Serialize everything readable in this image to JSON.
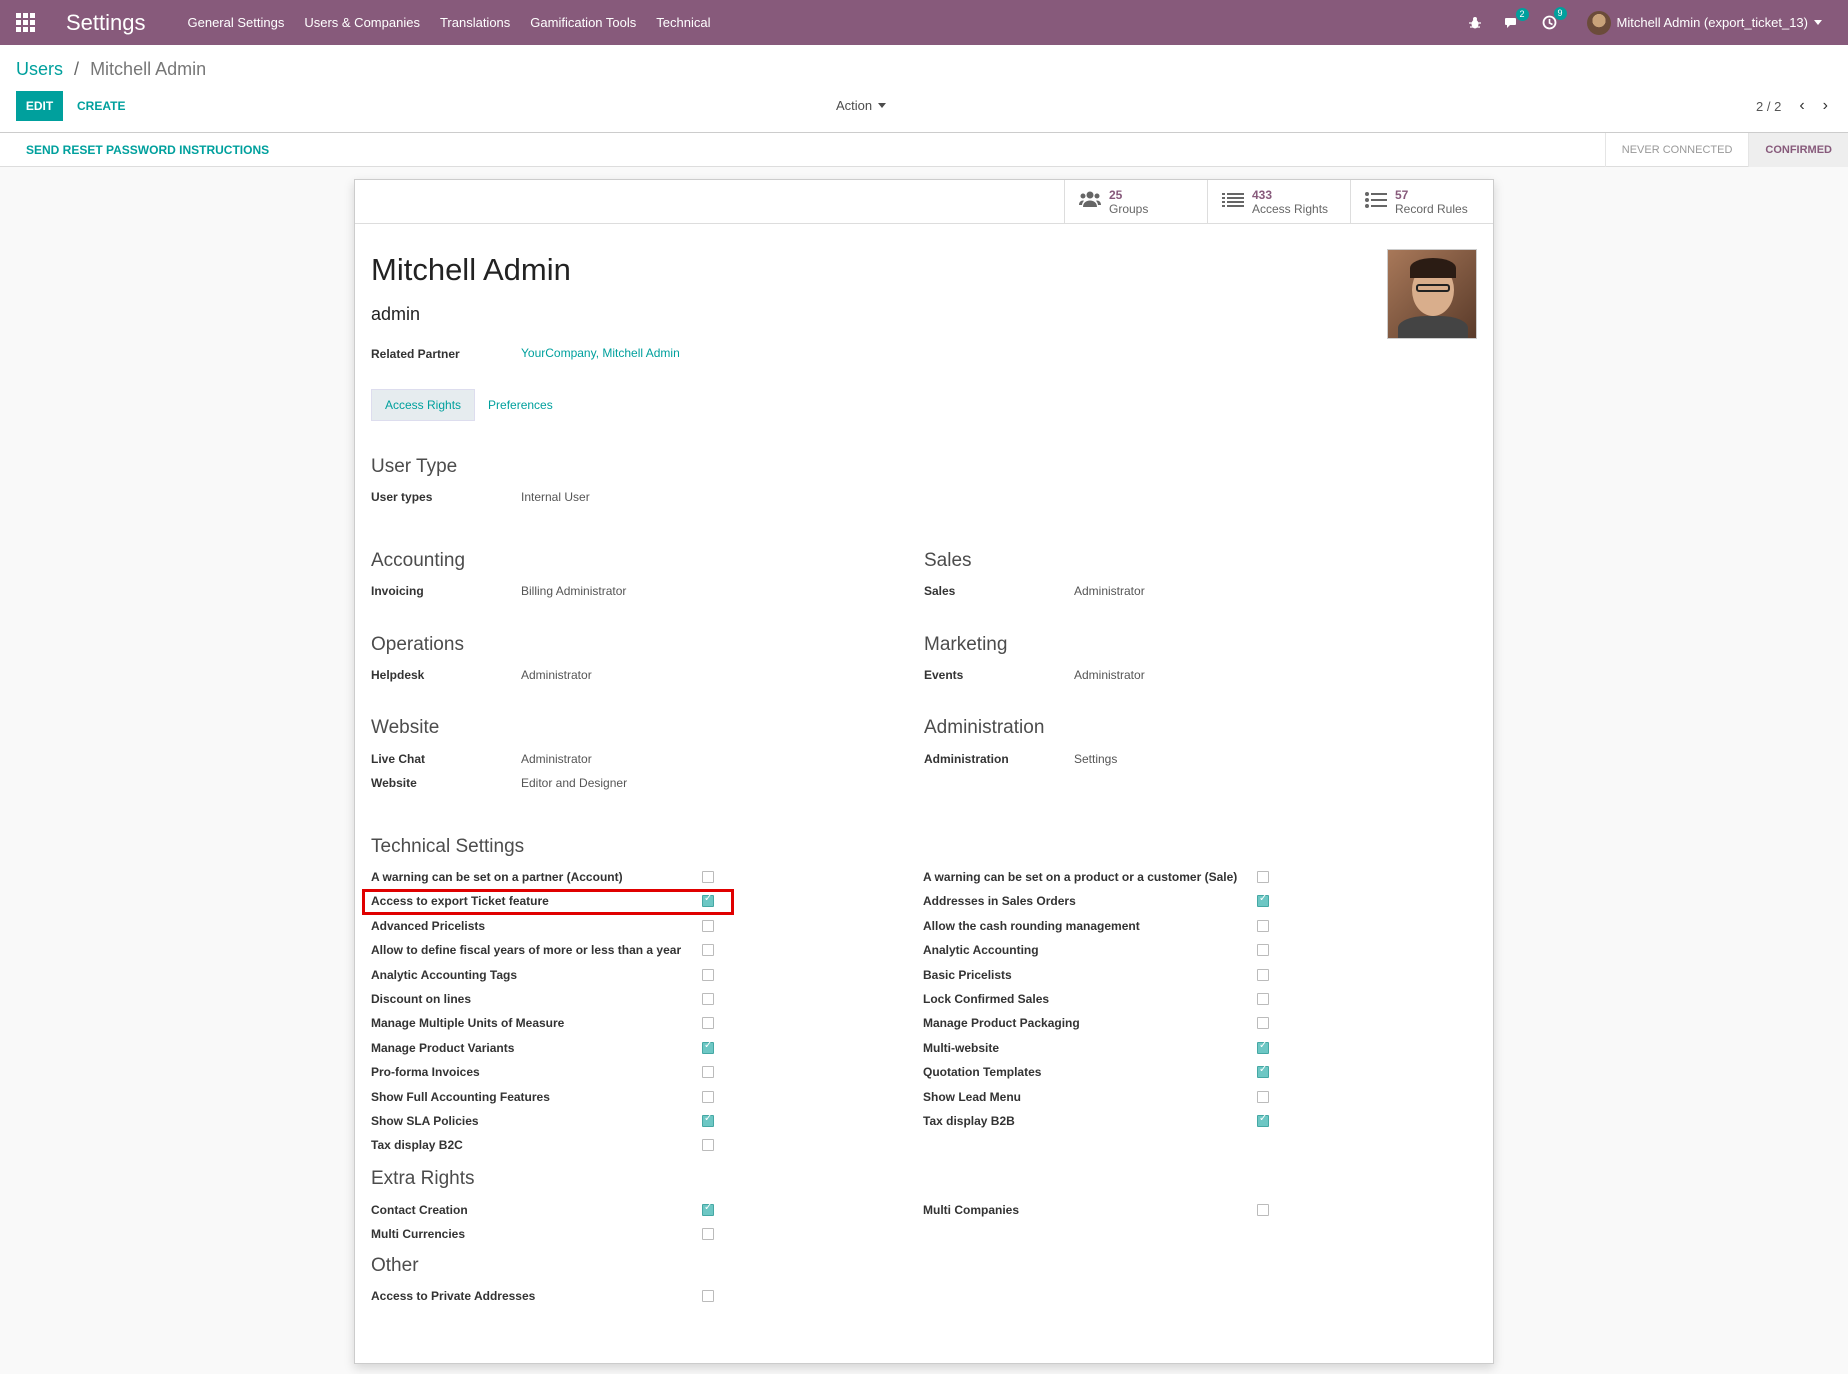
{
  "navbar": {
    "brand": "Settings",
    "menu": [
      "General Settings",
      "Users & Companies",
      "Translations",
      "Gamification Tools",
      "Technical"
    ],
    "messages_count": "2",
    "activities_count": "9",
    "user": "Mitchell Admin (export_ticket_13)",
    "color": "#875a7b"
  },
  "breadcrumb": {
    "parent": "Users",
    "separator": "/",
    "current": "Mitchell Admin"
  },
  "toolbar": {
    "edit": "EDIT",
    "create": "CREATE",
    "action": "Action",
    "pager": "2 / 2"
  },
  "statusbar": {
    "reset_password": "SEND RESET PASSWORD INSTRUCTIONS",
    "stages": [
      "NEVER CONNECTED",
      "CONFIRMED"
    ],
    "active_stage": "CONFIRMED"
  },
  "stats": [
    {
      "value": "25",
      "label": "Groups",
      "icon": "users-icon"
    },
    {
      "value": "433",
      "label": "Access Rights",
      "icon": "list-icon"
    },
    {
      "value": "57",
      "label": "Record Rules",
      "icon": "list-ul-icon"
    }
  ],
  "user": {
    "name": "Mitchell Admin",
    "login": "admin",
    "related_partner_label": "Related Partner",
    "related_partner": "YourCompany, Mitchell Admin"
  },
  "tabs": [
    "Access Rights",
    "Preferences"
  ],
  "user_type": {
    "title": "User Type",
    "label": "User types",
    "value": "Internal User"
  },
  "groups": {
    "accounting": {
      "title": "Accounting",
      "label": "Invoicing",
      "value": "Billing Administrator"
    },
    "sales": {
      "title": "Sales",
      "label": "Sales",
      "value": "Administrator"
    },
    "operations": {
      "title": "Operations",
      "label": "Helpdesk",
      "value": "Administrator"
    },
    "marketing": {
      "title": "Marketing",
      "label": "Events",
      "value": "Administrator"
    },
    "website": {
      "title": "Website",
      "rows": [
        {
          "label": "Live Chat",
          "value": "Administrator"
        },
        {
          "label": "Website",
          "value": "Editor and Designer"
        }
      ]
    },
    "administration": {
      "title": "Administration",
      "label": "Administration",
      "value": "Settings"
    }
  },
  "technical": {
    "title": "Technical Settings",
    "left": [
      {
        "label": "A warning can be set on a partner (Account)",
        "checked": false
      },
      {
        "label": "Access to export Ticket feature",
        "checked": true
      },
      {
        "label": "Advanced Pricelists",
        "checked": false
      },
      {
        "label": "Allow to define fiscal years of more or less than a year",
        "checked": false
      },
      {
        "label": "Analytic Accounting Tags",
        "checked": false
      },
      {
        "label": "Discount on lines",
        "checked": false
      },
      {
        "label": "Manage Multiple Units of Measure",
        "checked": false
      },
      {
        "label": "Manage Product Variants",
        "checked": true
      },
      {
        "label": "Pro-forma Invoices",
        "checked": false
      },
      {
        "label": "Show Full Accounting Features",
        "checked": false
      },
      {
        "label": "Show SLA Policies",
        "checked": true
      },
      {
        "label": "Tax display B2C",
        "checked": false
      }
    ],
    "right": [
      {
        "label": "A warning can be set on a product or a customer (Sale)",
        "checked": false
      },
      {
        "label": "Addresses in Sales Orders",
        "checked": true
      },
      {
        "label": "Allow the cash rounding management",
        "checked": false
      },
      {
        "label": "Analytic Accounting",
        "checked": false
      },
      {
        "label": "Basic Pricelists",
        "checked": false
      },
      {
        "label": "Lock Confirmed Sales",
        "checked": false
      },
      {
        "label": "Manage Product Packaging",
        "checked": false
      },
      {
        "label": "Multi-website",
        "checked": true
      },
      {
        "label": "Quotation Templates",
        "checked": true
      },
      {
        "label": "Show Lead Menu",
        "checked": false
      },
      {
        "label": "Tax display B2B",
        "checked": true
      }
    ]
  },
  "extra": {
    "title": "Extra Rights",
    "left": [
      {
        "label": "Contact Creation",
        "checked": true
      },
      {
        "label": "Multi Currencies",
        "checked": false
      }
    ],
    "right": [
      {
        "label": "Multi Companies",
        "checked": false
      }
    ]
  },
  "other": {
    "title": "Other",
    "left": [
      {
        "label": "Access to Private Addresses",
        "checked": false
      }
    ]
  },
  "accent_color": "#00a09d",
  "highlight_color": "#e00000"
}
